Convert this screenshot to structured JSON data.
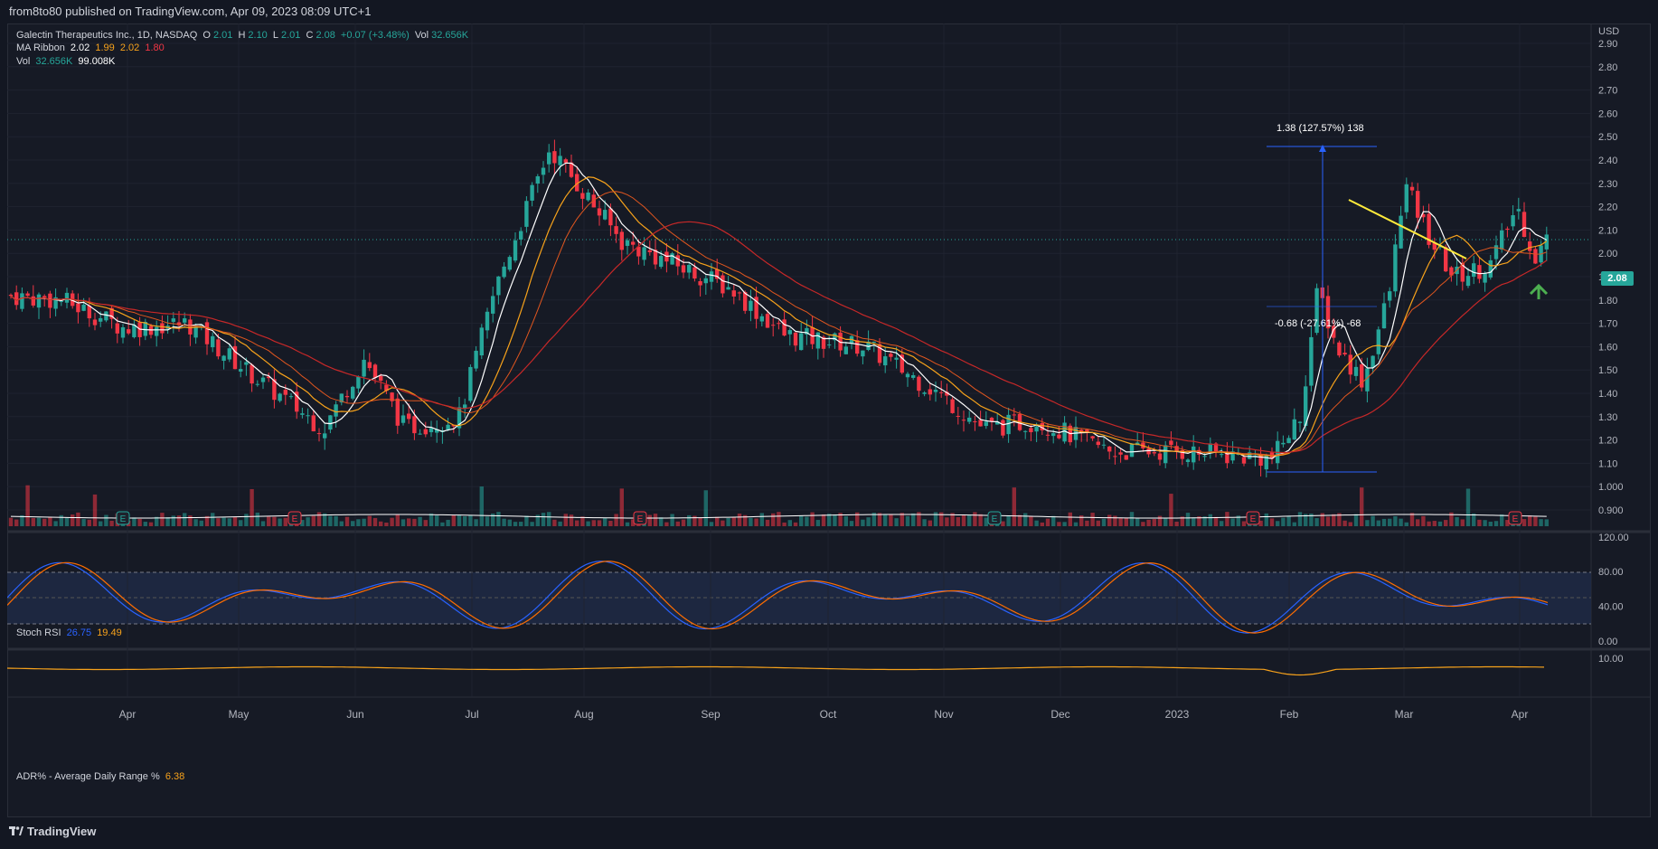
{
  "header": {
    "published": "from8to80 published on TradingView.com, Apr 09, 2023 08:09 UTC+1"
  },
  "legend": {
    "symbol": "Galectin Therapeutics Inc., 1D, NASDAQ",
    "ohlc": {
      "o_label": "O",
      "o": "2.01",
      "h_label": "H",
      "h": "2.10",
      "l_label": "L",
      "l": "2.01",
      "c_label": "C",
      "c": "2.08",
      "change": "+0.07 (+3.48%)",
      "vol_label": "Vol",
      "vol": "32.656K"
    },
    "ma_ribbon": {
      "label": "MA Ribbon",
      "v1": "2.02",
      "v2": "1.99",
      "v3": "2.02",
      "v4": "1.80"
    },
    "vol": {
      "label": "Vol",
      "v1": "32.656K",
      "v2": "99.008K"
    },
    "stoch": {
      "label": "Stoch RSI",
      "k": "26.75",
      "d": "19.49"
    },
    "adr": {
      "label": "ADR% - Average Daily Range %",
      "v": "6.38"
    }
  },
  "currency": "USD",
  "last_price": "2.08",
  "price_axis": [
    "2.90",
    "2.80",
    "2.70",
    "2.60",
    "2.50",
    "2.40",
    "2.30",
    "2.20",
    "2.10",
    "2.00",
    "1.90",
    "1.80",
    "1.70",
    "1.60",
    "1.50",
    "1.40",
    "1.30",
    "1.20",
    "1.10",
    "1.000",
    "0.900"
  ],
  "stoch_axis": [
    "120.00",
    "80.00",
    "40.00",
    "0.00"
  ],
  "adr_axis": [
    "10.00"
  ],
  "months": [
    "Apr",
    "May",
    "Jun",
    "Jul",
    "Aug",
    "Sep",
    "Oct",
    "Nov",
    "Dec",
    "2023",
    "Feb",
    "Mar",
    "Apr"
  ],
  "annotations": {
    "measure_up": "1.38 (127.57%) 138",
    "measure_down": "-0.68 (-27.61%) -68"
  },
  "earnings_marker": "E",
  "footer": {
    "brand": "TradingView"
  },
  "colors": {
    "up": "#26a69a",
    "down": "#f23645",
    "ma_fast": "#ffffff",
    "ma_mid": "#f7a21b",
    "ma_slow": "#e0561f",
    "ma_long": "#c62828",
    "stoch_k": "#2962ff",
    "stoch_d": "#ff6d00",
    "adr": "#f7a21b",
    "trendline": "#ffeb3b",
    "arrow": "#4caf50"
  }
}
